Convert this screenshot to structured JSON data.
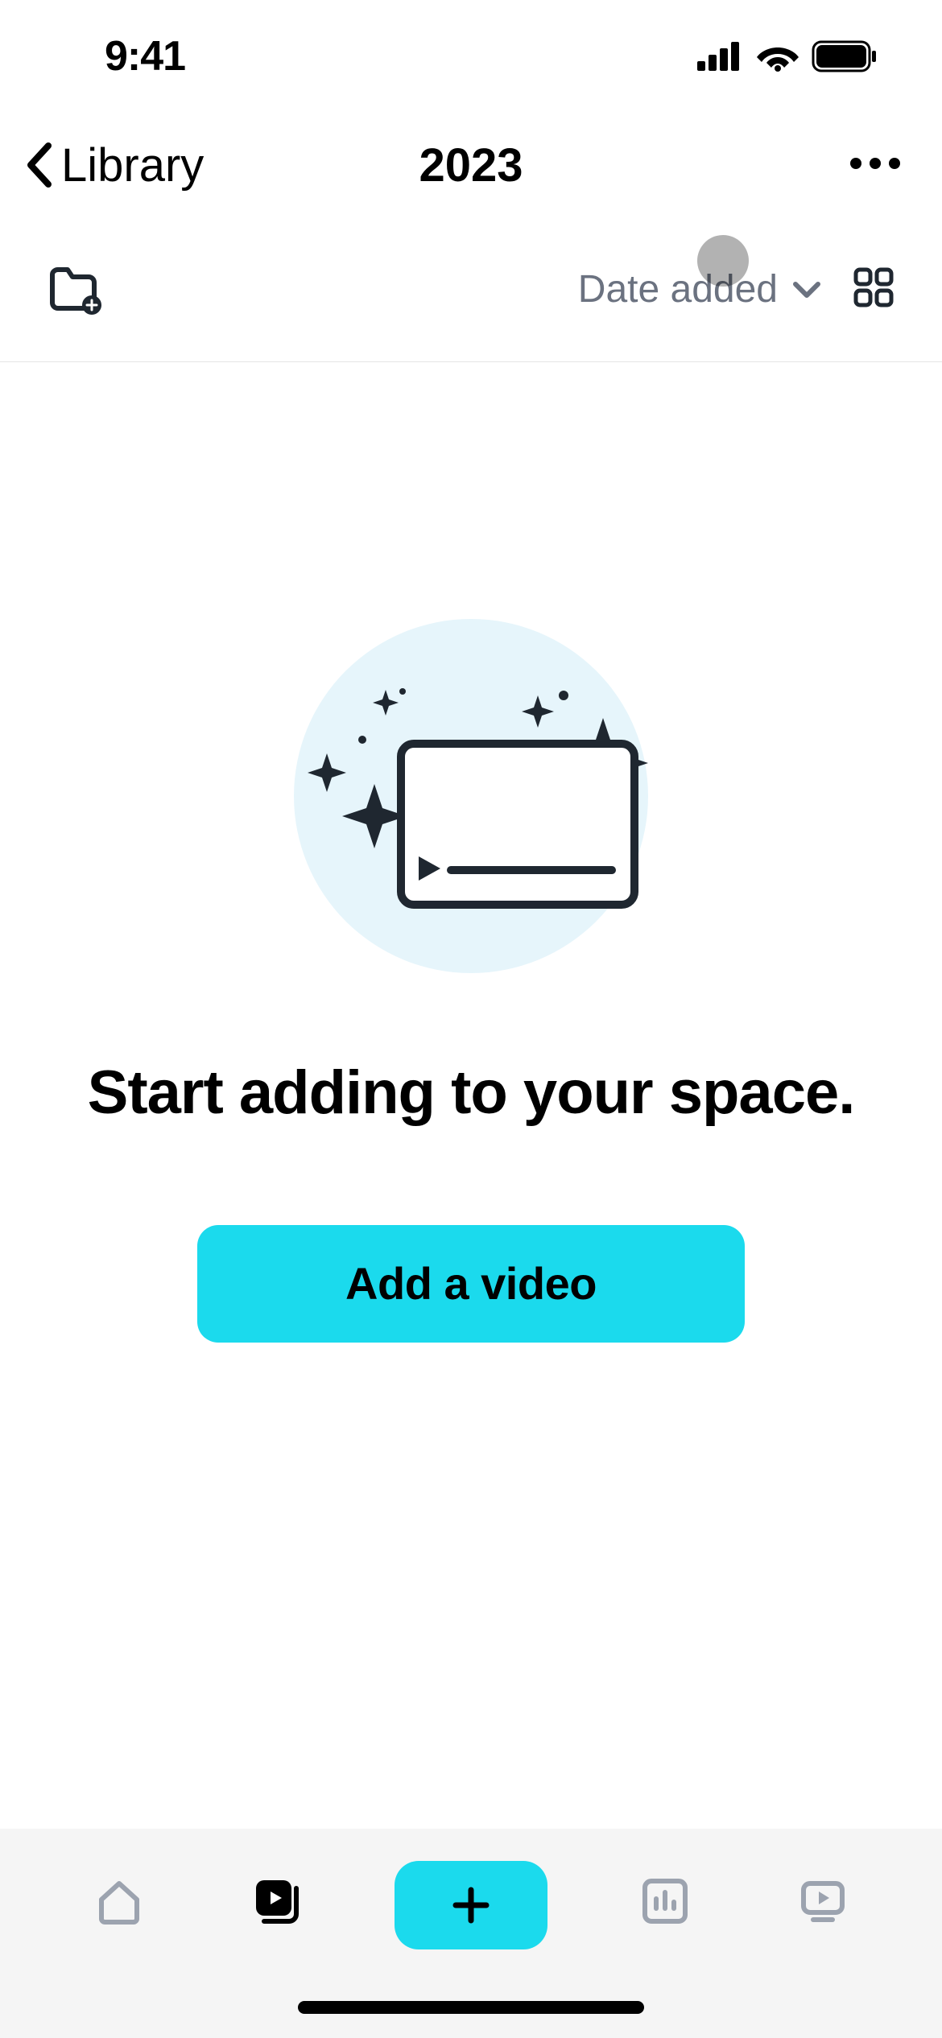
{
  "statusBar": {
    "time": "9:41"
  },
  "nav": {
    "backLabel": "Library",
    "title": "2023"
  },
  "toolbar": {
    "sortLabel": "Date added"
  },
  "emptyState": {
    "heading": "Start adding to your space.",
    "ctaLabel": "Add a video"
  }
}
